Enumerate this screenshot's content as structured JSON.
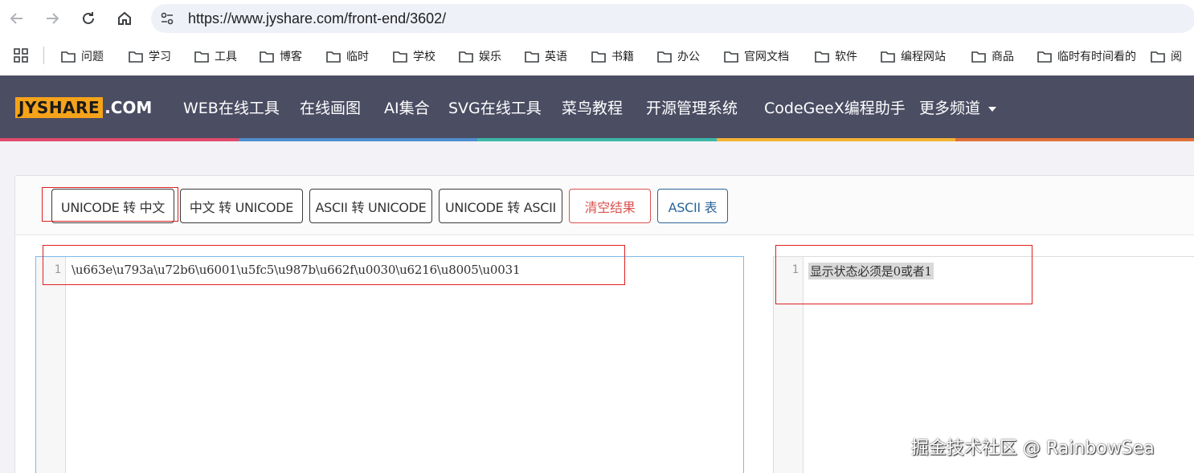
{
  "browser": {
    "url": "https://www.jyshare.com/front-end/3602/",
    "bookmarks": [
      "问题",
      "学习",
      "工具",
      "博客",
      "临时",
      "学校",
      "娱乐",
      "英语",
      "书籍",
      "办公",
      "官网文档",
      "软件",
      "编程网站",
      "商品",
      "临时有时间看的",
      "阅"
    ]
  },
  "site": {
    "logo_main": "JYSHARE",
    "logo_suffix": ".COM",
    "nav": [
      "WEB在线工具",
      "在线画图",
      "AI集合",
      "SVG在线工具",
      "菜鸟教程",
      "开源管理系统",
      "CodeGeeX编程助手",
      "更多频道"
    ],
    "stripe_colors": [
      "#e04b6b",
      "#4e8ecf",
      "#3cb8a8",
      "#f2b233",
      "#e0713a"
    ]
  },
  "toolbar": {
    "buttons": [
      "UNICODE 转 中文",
      "中文 转 UNICODE",
      "ASCII 转 UNICODE",
      "UNICODE 转 ASCII",
      "清空结果",
      "ASCII 表"
    ]
  },
  "editor_input": {
    "line_number": "1",
    "text": "\\u663e\\u793a\\u72b6\\u6001\\u5fc5\\u987b\\u662f\\u0030\\u6216\\u8005\\u0031"
  },
  "editor_output": {
    "line_number": "1",
    "text": "显示状态必须是0或者1"
  },
  "watermark": "掘金技术社区 @ RainbowSea"
}
